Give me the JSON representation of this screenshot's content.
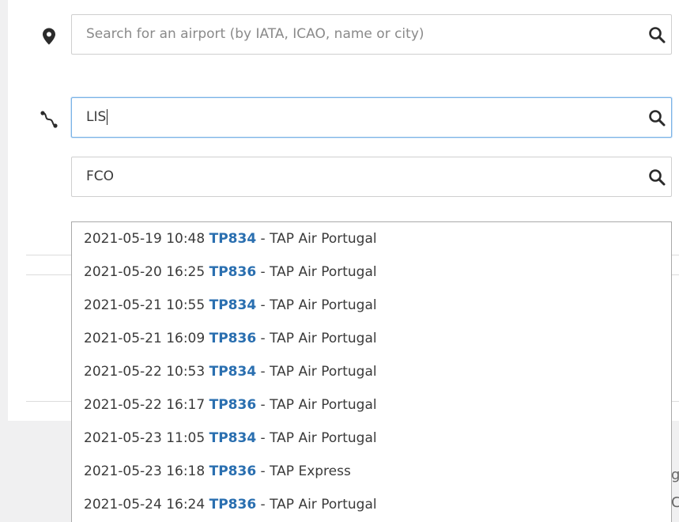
{
  "airport_search": {
    "placeholder": "Search for an airport (by IATA, ICAO, name or city)",
    "value": "",
    "icon": "location-pin-icon"
  },
  "route_search": {
    "icon": "route-icon",
    "origin": {
      "value": "LIS"
    },
    "destination": {
      "value": "FCO"
    }
  },
  "search_icon": "search-icon",
  "suggestions": [
    {
      "datetime": "2021-05-19 10:48",
      "flight": "TP834",
      "sep": " - ",
      "airline": "TAP Air Portugal"
    },
    {
      "datetime": "2021-05-20 16:25",
      "flight": "TP836",
      "sep": " - ",
      "airline": "TAP Air Portugal"
    },
    {
      "datetime": "2021-05-21 10:55",
      "flight": "TP834",
      "sep": " - ",
      "airline": "TAP Air Portugal"
    },
    {
      "datetime": "2021-05-21 16:09",
      "flight": "TP836",
      "sep": " - ",
      "airline": "TAP Air Portugal"
    },
    {
      "datetime": "2021-05-22 10:53",
      "flight": "TP834",
      "sep": " - ",
      "airline": "TAP Air Portugal"
    },
    {
      "datetime": "2021-05-22 16:17",
      "flight": "TP836",
      "sep": " - ",
      "airline": "TAP Air Portugal"
    },
    {
      "datetime": "2021-05-23 11:05",
      "flight": "TP834",
      "sep": " - ",
      "airline": "TAP Air Portugal"
    },
    {
      "datetime": "2021-05-23 16:18",
      "flight": "TP836",
      "sep": " - ",
      "airline": "TAP Express"
    },
    {
      "datetime": "2021-05-24 16:24",
      "flight": "TP836",
      "sep": " - ",
      "airline": "TAP Air Portugal"
    }
  ],
  "colors": {
    "flight_link": "#2a6fb0",
    "focus_border": "#7ab3e6"
  },
  "edge_glyphs": [
    "g",
    "C"
  ]
}
